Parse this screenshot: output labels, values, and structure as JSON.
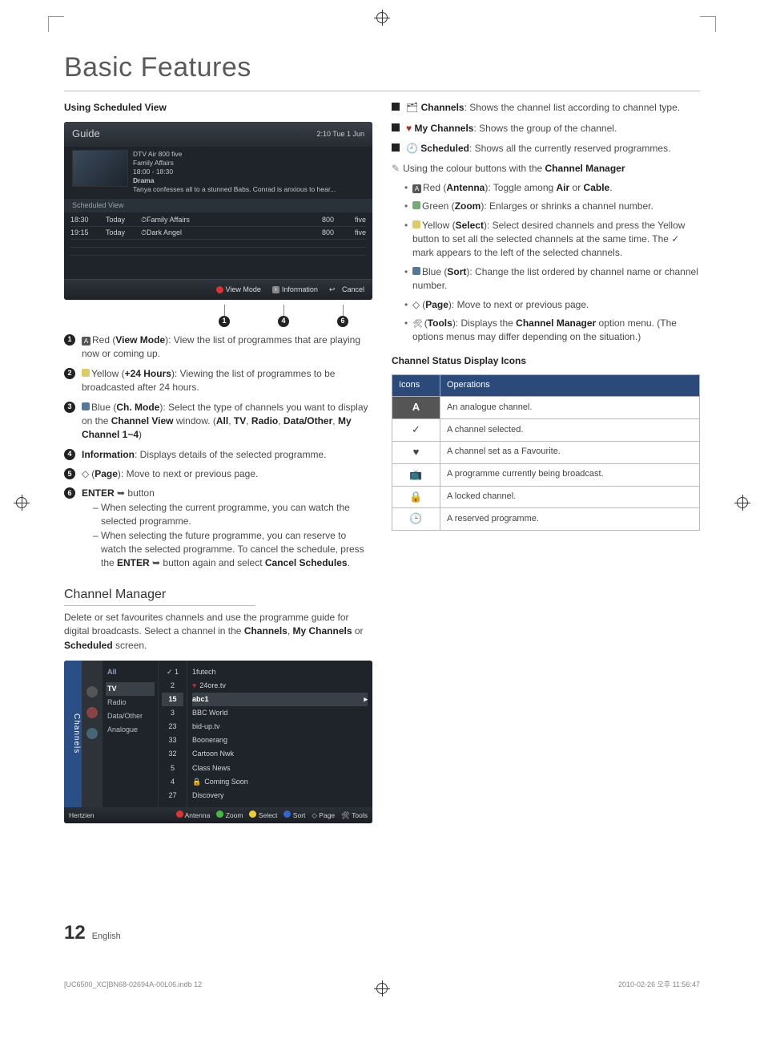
{
  "page": {
    "title": "Basic Features",
    "section": "Using Scheduled View",
    "number": "12",
    "language": "English",
    "footer_file": "[UC6500_XC]BN68-02694A-00L06.indb   12",
    "footer_time": "2010-02-26   오후 11:56:47"
  },
  "guide": {
    "title": "Guide",
    "clock": "2:10 Tue 1 Jun",
    "header_line1": "DTV Air 800 five",
    "header_line2": "Family Affairs",
    "header_line3": "18:00 - 18:30",
    "header_line4": "Drama",
    "header_desc": "Tanya confesses all to a stunned Babs. Conrad is anxious to hear...",
    "tab": "Scheduled View",
    "rows": [
      {
        "time": "18:30",
        "day": "Today",
        "name": "Family Affairs",
        "ch": "800",
        "st": "five",
        "pre": "⏱"
      },
      {
        "time": "19:15",
        "day": "Today",
        "name": "Dark Angel",
        "ch": "800",
        "st": "five",
        "pre": "⏱"
      }
    ],
    "bar_view": "View Mode",
    "bar_info": "Information",
    "bar_cancel": "Cancel",
    "pointers": [
      "1",
      "4",
      "6"
    ]
  },
  "numitems": {
    "i1a": "Red (",
    "i1b": "View Mode",
    "i1c": "): View the list of programmes that are playing now or coming up.",
    "i2a": "Yellow (",
    "i2b": "+24 Hours",
    "i2c": "): Viewing the list of programmes to be broadcasted after 24 hours.",
    "i3a": "Blue (",
    "i3b": "Ch. Mode",
    "i3c": "): Select the type of channels you want to display on the ",
    "i3d": "Channel View",
    "i3e": " window. (",
    "i3f": "All",
    "i3g": ", ",
    "i3h": "TV",
    "i3i": ", ",
    "i3j": "Radio",
    "i3k": ", ",
    "i3l": "Data/Other",
    "i3m": ", ",
    "i3n": "My Channel 1~4",
    "i3o": ")",
    "i4a": "Information",
    "i4b": ": Displays details of the selected programme.",
    "i5a": "(",
    "i5b": "Page",
    "i5c": "): Move to next or previous page.",
    "i6a": "ENTER",
    "i6b": " button",
    "i6d1": "When selecting the current programme, you can watch the selected programme.",
    "i6d2a": "When selecting the future programme, you can reserve to watch the selected programme. To cancel the schedule, press the ",
    "i6d2b": "ENTER",
    "i6d2c": " button again and select ",
    "i6d2d": "Cancel Schedules",
    "i6d2e": "."
  },
  "cm": {
    "h2": "Channel Manager",
    "intro_a": "Delete or set favourites channels and use the programme guide for digital broadcasts. Select a channel in the ",
    "intro_b": "Channels",
    "intro_c": ", ",
    "intro_d": "My Channels",
    "intro_e": " or ",
    "intro_f": "Scheduled",
    "intro_g": " screen.",
    "side": "Channels",
    "cats_hdr": "All",
    "cats": [
      "TV",
      "Radio",
      "Data/Other",
      "Analogue"
    ],
    "nums_top": [
      "1",
      "2"
    ],
    "nums_sel": "15",
    "nums": [
      "3",
      "23",
      "33",
      "32",
      "5",
      "4",
      "27"
    ],
    "names_top": [
      "1futech",
      "24ore.tv"
    ],
    "names_sel": "abc1",
    "names": [
      "BBC World",
      "bid-up.tv",
      "Boonerang",
      "Cartoon Nwk",
      "Class News",
      "Coming Soon",
      "Discovery"
    ],
    "foot_hertz": "Hertzien",
    "foot_items": [
      "Antenna",
      "Zoom",
      "Select",
      "Sort",
      "Page",
      "Tools"
    ]
  },
  "right": {
    "b1a": "Channels",
    "b1b": ": Shows the channel list according to channel type.",
    "b2a": "My Channels",
    "b2b": ": Shows the group of the channel.",
    "b3a": "Scheduled",
    "b3b": ": Shows all the currently reserved programmes.",
    "note": "Using the colour buttons with the ",
    "note_b": "Channel Manager",
    "u1a": "Red (",
    "u1b": "Antenna",
    "u1c": "): Toggle among ",
    "u1d": "Air",
    "u1e": " or ",
    "u1f": "Cable",
    "u1g": ".",
    "u2a": "Green (",
    "u2b": "Zoom",
    "u2c": "): Enlarges or shrinks a channel number.",
    "u3a": "Yellow (",
    "u3b": "Select",
    "u3c": "): Select desired channels and press the Yellow button to set all the selected channels at the same time. The ",
    "u3d": " mark appears to the left of the selected channels.",
    "u4a": "Blue (",
    "u4b": "Sort",
    "u4c": "): Change the list ordered by channel name or channel number.",
    "u5a": "(",
    "u5b": "Page",
    "u5c": "): Move to next or previous page.",
    "u6a": "(",
    "u6b": "Tools",
    "u6c": "): Displays the ",
    "u6d": "Channel Manager",
    "u6e": " option menu. (The options menus may differ depending on the situation.)",
    "status_h": "Channel Status Display Icons",
    "th1": "Icons",
    "th2": "Operations",
    "rows": [
      {
        "ic": "A",
        "op": "An analogue channel."
      },
      {
        "ic": "✓",
        "op": "A channel selected."
      },
      {
        "ic": "♥",
        "op": "A channel set as a Favourite."
      },
      {
        "ic": "📺",
        "op": "A programme currently being broadcast."
      },
      {
        "ic": "🔒",
        "op": "A locked channel."
      },
      {
        "ic": "🕒",
        "op": "A reserved programme."
      }
    ]
  }
}
